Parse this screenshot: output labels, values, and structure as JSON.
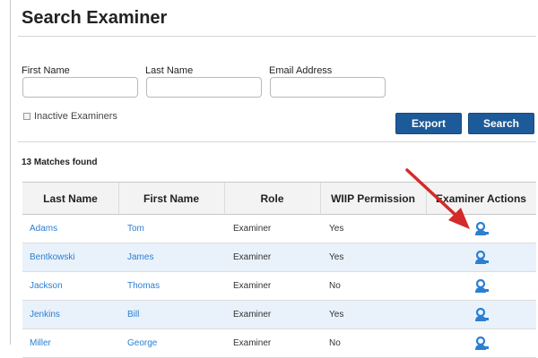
{
  "page": {
    "title": "Search Examiner"
  },
  "filters": {
    "first_name_label": "First Name",
    "last_name_label": "Last Name",
    "email_label": "Email Address",
    "first_name_value": "",
    "last_name_value": "",
    "email_value": "",
    "inactive_label": "Inactive Examiners",
    "inactive_checked": false
  },
  "buttons": {
    "export": "Export",
    "search": "Search"
  },
  "results": {
    "count_text": "13 Matches found",
    "columns": [
      "Last Name",
      "First Name",
      "Role",
      "WIIP Permission",
      "Examiner Actions"
    ],
    "rows": [
      {
        "last": "Adams",
        "first": "Tom",
        "role": "Examiner",
        "wiip": "Yes"
      },
      {
        "last": "Bentkowski",
        "first": "James",
        "role": "Examiner",
        "wiip": "Yes"
      },
      {
        "last": "Jackson",
        "first": "Thomas",
        "role": "Examiner",
        "wiip": "No"
      },
      {
        "last": "Jenkins",
        "first": "Bill",
        "role": "Examiner",
        "wiip": "Yes"
      },
      {
        "last": "Miller",
        "first": "George",
        "role": "Examiner",
        "wiip": "No"
      }
    ]
  },
  "icons": {
    "action": "edit-user-icon"
  },
  "colors": {
    "button": "#1d5a99",
    "link": "#2a7fd4",
    "row_alt": "#e9f2fb",
    "arrow": "#d42a2a"
  }
}
